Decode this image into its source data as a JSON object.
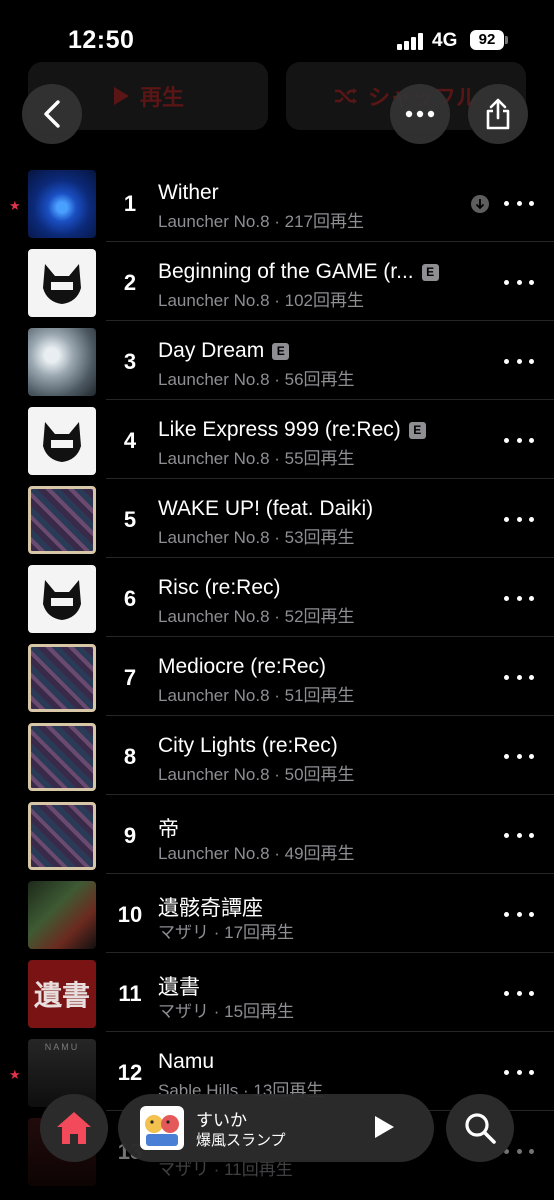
{
  "status_bar": {
    "time": "12:50",
    "network": "4G",
    "battery": "92"
  },
  "header": {
    "play_label": "再生",
    "shuffle_label": "シャッフル"
  },
  "tracks": [
    {
      "number": "1",
      "title": "Wither",
      "artist": "Launcher No.8",
      "plays": "217回再生",
      "explicit": false,
      "starred": true,
      "downloaded": true
    },
    {
      "number": "2",
      "title": "Beginning of the GAME (r...",
      "artist": "Launcher No.8",
      "plays": "102回再生",
      "explicit": true,
      "starred": false
    },
    {
      "number": "3",
      "title": "Day Dream",
      "artist": "Launcher No.8",
      "plays": "56回再生",
      "explicit": true,
      "starred": false
    },
    {
      "number": "4",
      "title": "Like Express 999 (re:Rec)",
      "artist": "Launcher No.8",
      "plays": "55回再生",
      "explicit": true,
      "starred": false
    },
    {
      "number": "5",
      "title": "WAKE UP! (feat. Daiki)",
      "artist": "Launcher No.8",
      "plays": "53回再生",
      "explicit": false,
      "starred": false
    },
    {
      "number": "6",
      "title": "Risc (re:Rec)",
      "artist": "Launcher No.8",
      "plays": "52回再生",
      "explicit": false,
      "starred": false
    },
    {
      "number": "7",
      "title": "Mediocre (re:Rec)",
      "artist": "Launcher No.8",
      "plays": "51回再生",
      "explicit": false,
      "starred": false
    },
    {
      "number": "8",
      "title": "City Lights (re:Rec)",
      "artist": "Launcher No.8",
      "plays": "50回再生",
      "explicit": false,
      "starred": false
    },
    {
      "number": "9",
      "title": "帝",
      "artist": "Launcher No.8",
      "plays": "49回再生",
      "explicit": false,
      "starred": false
    },
    {
      "number": "10",
      "title": "遺骸奇譚座",
      "artist": "マザリ",
      "plays": "17回再生",
      "explicit": false,
      "starred": false
    },
    {
      "number": "11",
      "title": "遺書",
      "artist": "マザリ",
      "plays": "15回再生",
      "explicit": false,
      "starred": false
    },
    {
      "number": "12",
      "title": "Namu",
      "artist": "Sable Hills",
      "plays": "13回再生",
      "explicit": false,
      "starred": true
    },
    {
      "number": "13",
      "title": "",
      "artist": "マザリ",
      "plays": "11回再生",
      "explicit": false,
      "starred": false
    }
  ],
  "explicit_badge": "E",
  "art_text": {
    "red_cover": "遺書",
    "dark_cover": "NAMU"
  },
  "mini_player": {
    "title": "すいか",
    "artist": "爆風スランプ"
  },
  "colors": {
    "accent": "#e0344a",
    "secondary_text": "#8e8e93",
    "background": "#000000"
  }
}
